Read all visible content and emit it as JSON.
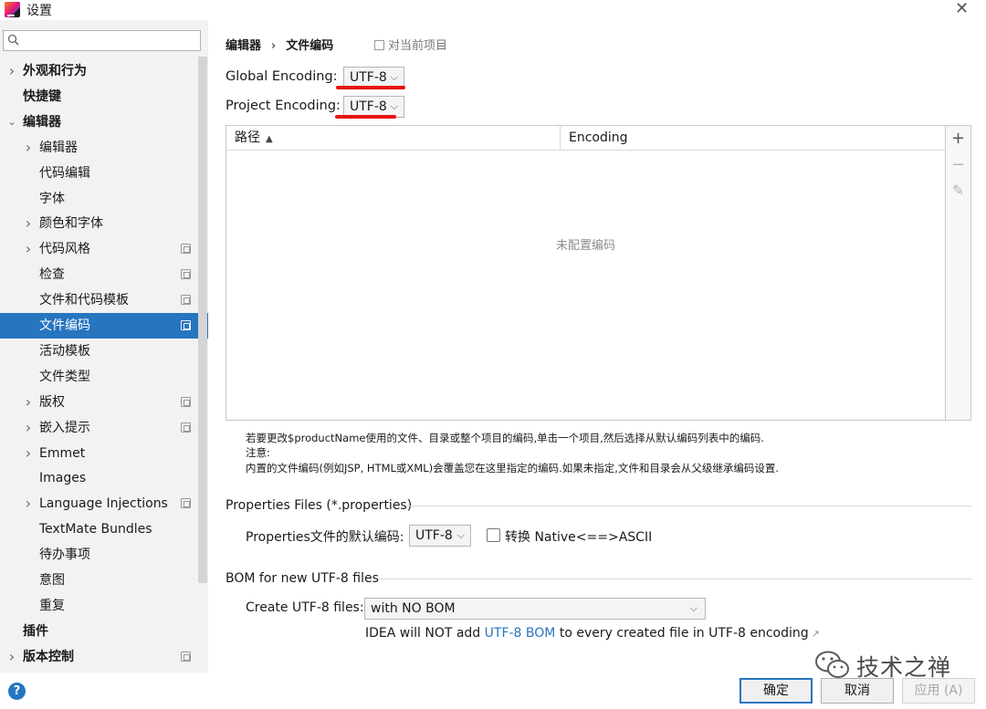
{
  "window": {
    "title": "设置"
  },
  "sidebar": {
    "search_placeholder": "",
    "items": [
      {
        "label": "外观和行为",
        "level": 0,
        "chevron": ">",
        "bold": true
      },
      {
        "label": "快捷键",
        "level": 0,
        "chevron": "",
        "bold": true
      },
      {
        "label": "编辑器",
        "level": 0,
        "chevron": "v",
        "bold": true
      },
      {
        "label": "编辑器",
        "level": 1,
        "chevron": ">"
      },
      {
        "label": "代码编辑",
        "level": 1,
        "chevron": ""
      },
      {
        "label": "字体",
        "level": 1,
        "chevron": ""
      },
      {
        "label": "颜色和字体",
        "level": 1,
        "chevron": ">"
      },
      {
        "label": "代码风格",
        "level": 1,
        "chevron": ">",
        "project": true
      },
      {
        "label": "检查",
        "level": 1,
        "chevron": "",
        "project": true
      },
      {
        "label": "文件和代码模板",
        "level": 1,
        "chevron": "",
        "project": true
      },
      {
        "label": "文件编码",
        "level": 1,
        "chevron": "",
        "project": true,
        "selected": true
      },
      {
        "label": "活动模板",
        "level": 1,
        "chevron": ""
      },
      {
        "label": "文件类型",
        "level": 1,
        "chevron": ""
      },
      {
        "label": "版权",
        "level": 1,
        "chevron": ">",
        "project": true
      },
      {
        "label": "嵌入提示",
        "level": 1,
        "chevron": ">",
        "project": true
      },
      {
        "label": "Emmet",
        "level": 1,
        "chevron": ">"
      },
      {
        "label": "Images",
        "level": 1,
        "chevron": ""
      },
      {
        "label": "Language Injections",
        "level": 1,
        "chevron": ">",
        "project": true
      },
      {
        "label": "TextMate Bundles",
        "level": 1,
        "chevron": ""
      },
      {
        "label": "待办事项",
        "level": 1,
        "chevron": ""
      },
      {
        "label": "意图",
        "level": 1,
        "chevron": ""
      },
      {
        "label": "重复",
        "level": 1,
        "chevron": ""
      },
      {
        "label": "插件",
        "level": 0,
        "chevron": "",
        "bold": true
      },
      {
        "label": "版本控制",
        "level": 0,
        "chevron": ">",
        "bold": true,
        "project": true
      }
    ]
  },
  "breadcrumb": {
    "parent": "编辑器",
    "separator": "›",
    "current": "文件编码"
  },
  "scope_label": "对当前项目",
  "encoding": {
    "global_label": "Global Encoding:",
    "global_value": "UTF-8",
    "project_label": "Project Encoding:",
    "project_value": "UTF-8"
  },
  "table": {
    "columns": [
      "路径",
      "Encoding"
    ],
    "sort_indicator": "▲",
    "empty_text": "未配置编码",
    "toolbar": {
      "add": "+",
      "remove": "−",
      "edit": "✎"
    }
  },
  "notes": [
    "若要更改$productName使用的文件、目录或整个项目的编码,单击一个项目,然后选择从默认编码列表中的编码.",
    "注意:",
    "内置的文件编码(例如JSP, HTML或XML)会覆盖您在这里指定的编码.如果未指定,文件和目录会从父级继承编码设置."
  ],
  "properties": {
    "section_title": "Properties Files (*.properties)",
    "default_label": "Properties文件的默认编码:",
    "default_value": "UTF-8",
    "native_checkbox_label": "转换 Native<==>ASCII",
    "native_checked": false
  },
  "bom": {
    "section_title": "BOM for new UTF-8 files",
    "create_label": "Create UTF-8 files:",
    "create_value": "with NO BOM",
    "info_before": "IDEA will NOT add ",
    "info_link": "UTF-8 BOM",
    "info_after": " to every created file in UTF-8 encoding"
  },
  "footer": {
    "help": "?",
    "ok": "确定",
    "cancel": "取消",
    "apply": "应用 (A)"
  },
  "watermark": {
    "text": "技术之禅"
  },
  "colors": {
    "accent": "#2675bf",
    "highlight_underline": "#e81010",
    "link": "#2675bf"
  }
}
